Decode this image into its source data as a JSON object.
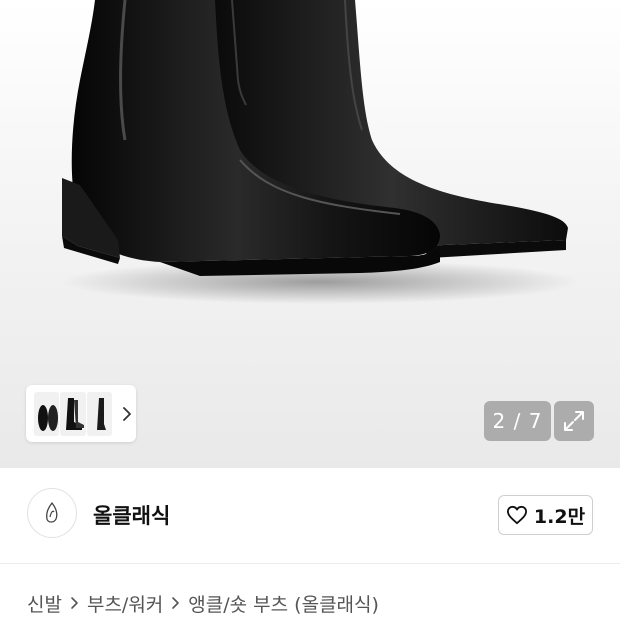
{
  "gallery": {
    "counter_text": "2 / 7",
    "expand_icon": "expand-arrows-icon",
    "next_icon": "chevron-right-icon"
  },
  "brand": {
    "name": "올클래식",
    "logo_icon": "brand-logo-icon",
    "likes": "1.2만",
    "like_icon": "heart-outline-icon"
  },
  "breadcrumb": {
    "items": [
      "신발",
      "부츠/워커",
      "앵클/숏 부츠 (올클래식)"
    ],
    "separator_icon": "chevron-right-icon"
  },
  "colors": {
    "accent": "#111111",
    "overlay": "#787878",
    "muted_text": "#555555"
  }
}
